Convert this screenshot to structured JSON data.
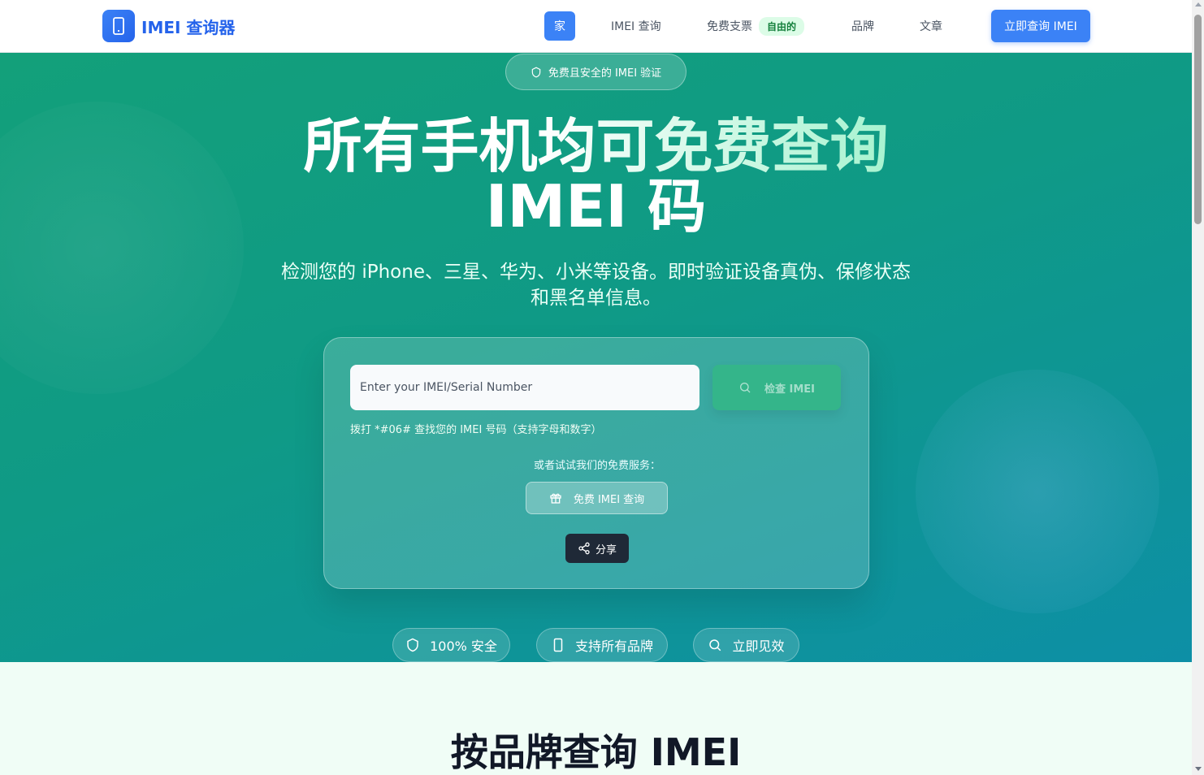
{
  "header": {
    "logo_text": "IMEI 查询器",
    "nav": {
      "home": "家",
      "imei": "IMEI 查询",
      "free": "免费支票",
      "free_badge": "自由的",
      "brand": "品牌",
      "article": "文章"
    },
    "cta": "立即查询 IMEI"
  },
  "hero": {
    "pill": "免费且安全的 IMEI 验证",
    "title_line1_white": "所有手机",
    "title_line1_rest": "均可免费查询",
    "title_line2": "IMEI 码",
    "subtitle": "检测您的 iPhone、三星、华为、小米等设备。即时验证设备真伪、保修状态和黑名单信息。",
    "form": {
      "placeholder": "Enter your IMEI/Serial Number",
      "check_button": "检查 IMEI",
      "hint": "拨打 *#06# 查找您的 IMEI 号码（支持字母和数字）",
      "alt_text": "或者试试我们的免费服务：",
      "free_button": "免费 IMEI 查询",
      "share_button": "分享"
    },
    "features": [
      "100% 安全",
      "支持所有品牌",
      "立即见效"
    ]
  },
  "brands_section": {
    "title": "按品牌查询 IMEI"
  }
}
